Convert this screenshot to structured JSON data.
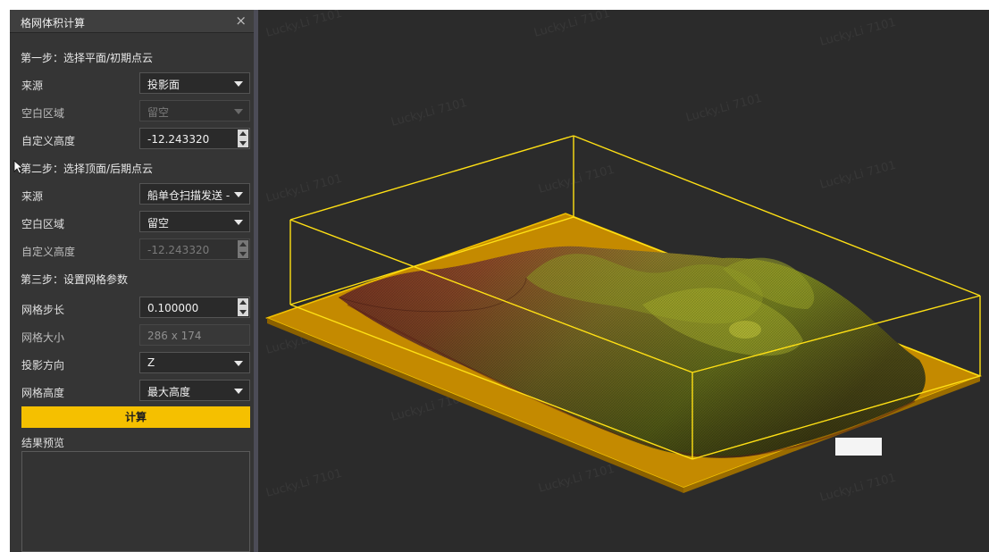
{
  "panel": {
    "title": "格网体积计算",
    "close_glyph": "×",
    "step1": {
      "heading": "第一步：选择平面/初期点云",
      "source_label": "来源",
      "source_value": "投影面",
      "empty_label": "空白区域",
      "empty_value": "留空",
      "height_label": "自定义高度",
      "height_value": "-12.243320"
    },
    "step2": {
      "heading": "第二步：选择顶面/后期点云",
      "source_label": "来源",
      "source_value": "船单仓扫描发送 - C",
      "empty_label": "空白区域",
      "empty_value": "留空",
      "height_label": "自定义高度",
      "height_value": "-12.243320"
    },
    "step3": {
      "heading": "第三步：设置网格参数",
      "step_label": "网格步长",
      "step_value": "0.100000",
      "size_label": "网格大小",
      "size_value": "286 x 174",
      "dir_label": "投影方向",
      "dir_value": "Z",
      "gridh_label": "网格高度",
      "gridh_value": "最大高度"
    },
    "calc_label": "计算",
    "preview_label": "结果预览"
  },
  "watermark_text": "Lucky.Li 7101",
  "icons": {
    "close": "close-icon",
    "dropdown": "chevron-down-icon",
    "spin_up": "spin-up-icon",
    "spin_down": "spin-down-icon",
    "cursor": "mouse-cursor-icon"
  },
  "colors": {
    "accent": "#f5c000",
    "bbox": "#ffe014",
    "plane": "#c98e00",
    "viewport_bg": "#2b2b2b",
    "panel_bg": "#353535"
  }
}
